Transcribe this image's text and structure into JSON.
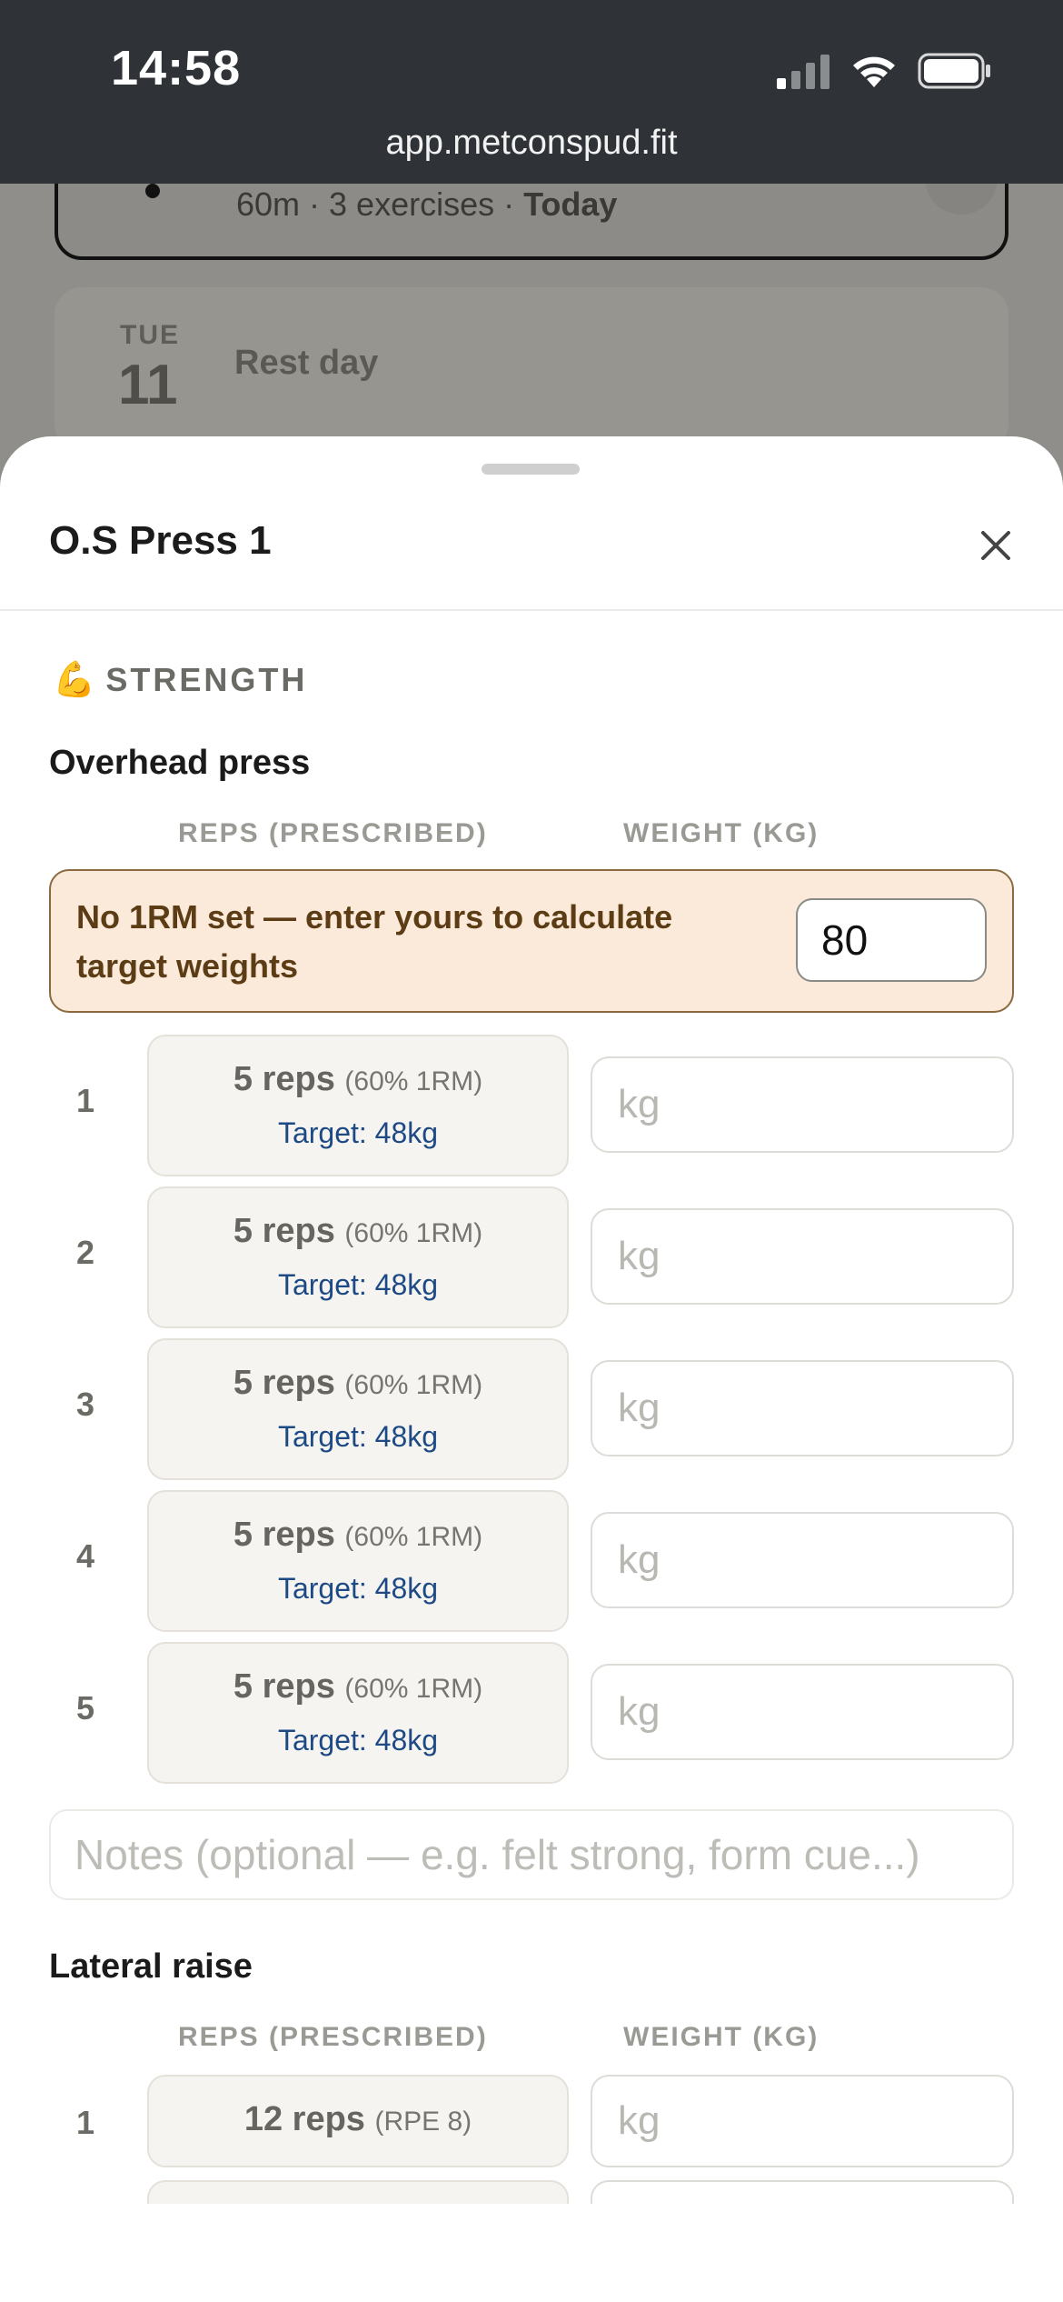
{
  "status_bar": {
    "time": "14:58",
    "url": "app.metconspud.fit"
  },
  "background": {
    "today_card": {
      "meta_prefix": "60m · 3 exercises · ",
      "meta_today": "Today"
    },
    "rest_card": {
      "dow": "TUE",
      "day": "11",
      "label": "Rest day"
    }
  },
  "sheet": {
    "title": "O.S Press 1",
    "category": {
      "emoji": "💪",
      "label": "STRENGTH"
    },
    "exercises": [
      {
        "name": "Overhead press",
        "col_reps": "REPS (PRESCRIBED)",
        "col_weight": "WEIGHT (KG)",
        "notice": "No 1RM set — enter yours to calculate target weights",
        "one_rm_value": "80",
        "sets": [
          {
            "num": "1",
            "reps": "5 reps",
            "pct": "(60% 1RM)",
            "target": "Target: 48kg",
            "placeholder": "kg"
          },
          {
            "num": "2",
            "reps": "5 reps",
            "pct": "(60% 1RM)",
            "target": "Target: 48kg",
            "placeholder": "kg"
          },
          {
            "num": "3",
            "reps": "5 reps",
            "pct": "(60% 1RM)",
            "target": "Target: 48kg",
            "placeholder": "kg"
          },
          {
            "num": "4",
            "reps": "5 reps",
            "pct": "(60% 1RM)",
            "target": "Target: 48kg",
            "placeholder": "kg"
          },
          {
            "num": "5",
            "reps": "5 reps",
            "pct": "(60% 1RM)",
            "target": "Target: 48kg",
            "placeholder": "kg"
          }
        ],
        "notes_placeholder": "Notes (optional — e.g. felt strong, form cue...)"
      },
      {
        "name": "Lateral raise",
        "col_reps": "REPS (PRESCRIBED)",
        "col_weight": "WEIGHT (KG)",
        "sets": [
          {
            "num": "1",
            "reps": "12 reps",
            "pct": "(RPE 8)",
            "placeholder": "kg"
          }
        ]
      }
    ]
  }
}
